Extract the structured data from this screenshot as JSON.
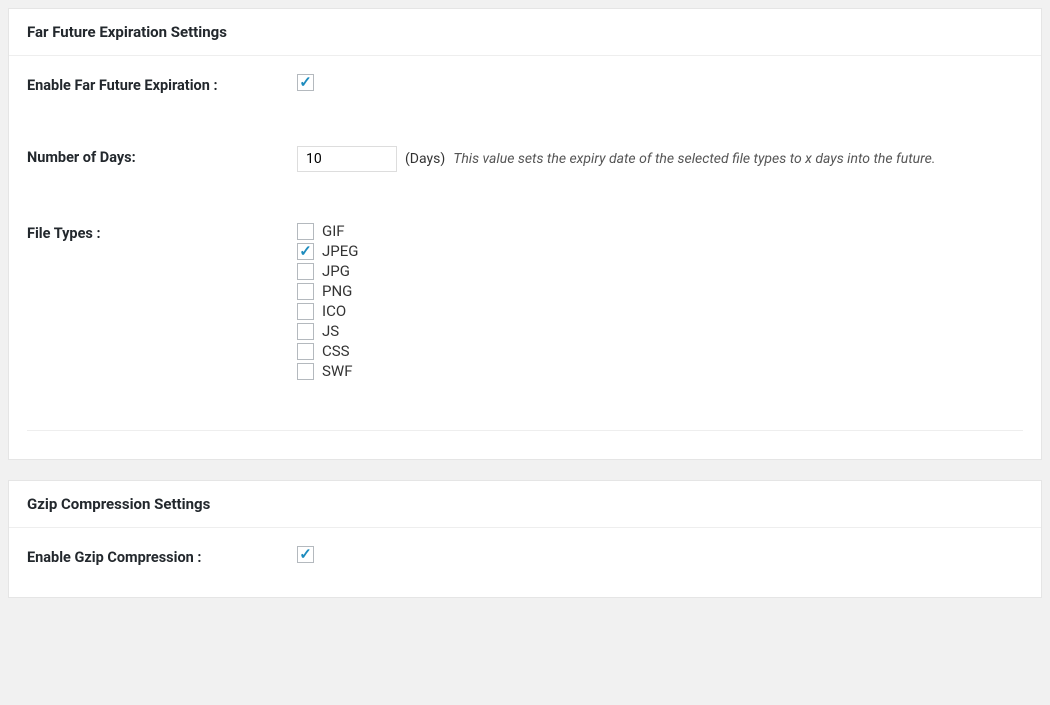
{
  "farFuture": {
    "title": "Far Future Expiration Settings",
    "enableLabel": "Enable Far Future Expiration :",
    "enableChecked": true,
    "daysLabel": "Number of Days:",
    "daysValue": "10",
    "daysSuffix": "(Days)",
    "daysDescription": "This value sets the expiry date of the selected file types to x days into the future.",
    "fileTypesLabel": "File Types :",
    "fileTypes": [
      {
        "label": "GIF",
        "checked": false
      },
      {
        "label": "JPEG",
        "checked": true
      },
      {
        "label": "JPG",
        "checked": false
      },
      {
        "label": "PNG",
        "checked": false
      },
      {
        "label": "ICO",
        "checked": false
      },
      {
        "label": "JS",
        "checked": false
      },
      {
        "label": "CSS",
        "checked": false
      },
      {
        "label": "SWF",
        "checked": false
      }
    ]
  },
  "gzip": {
    "title": "Gzip Compression Settings",
    "enableLabel": "Enable Gzip Compression :",
    "enableChecked": true
  }
}
